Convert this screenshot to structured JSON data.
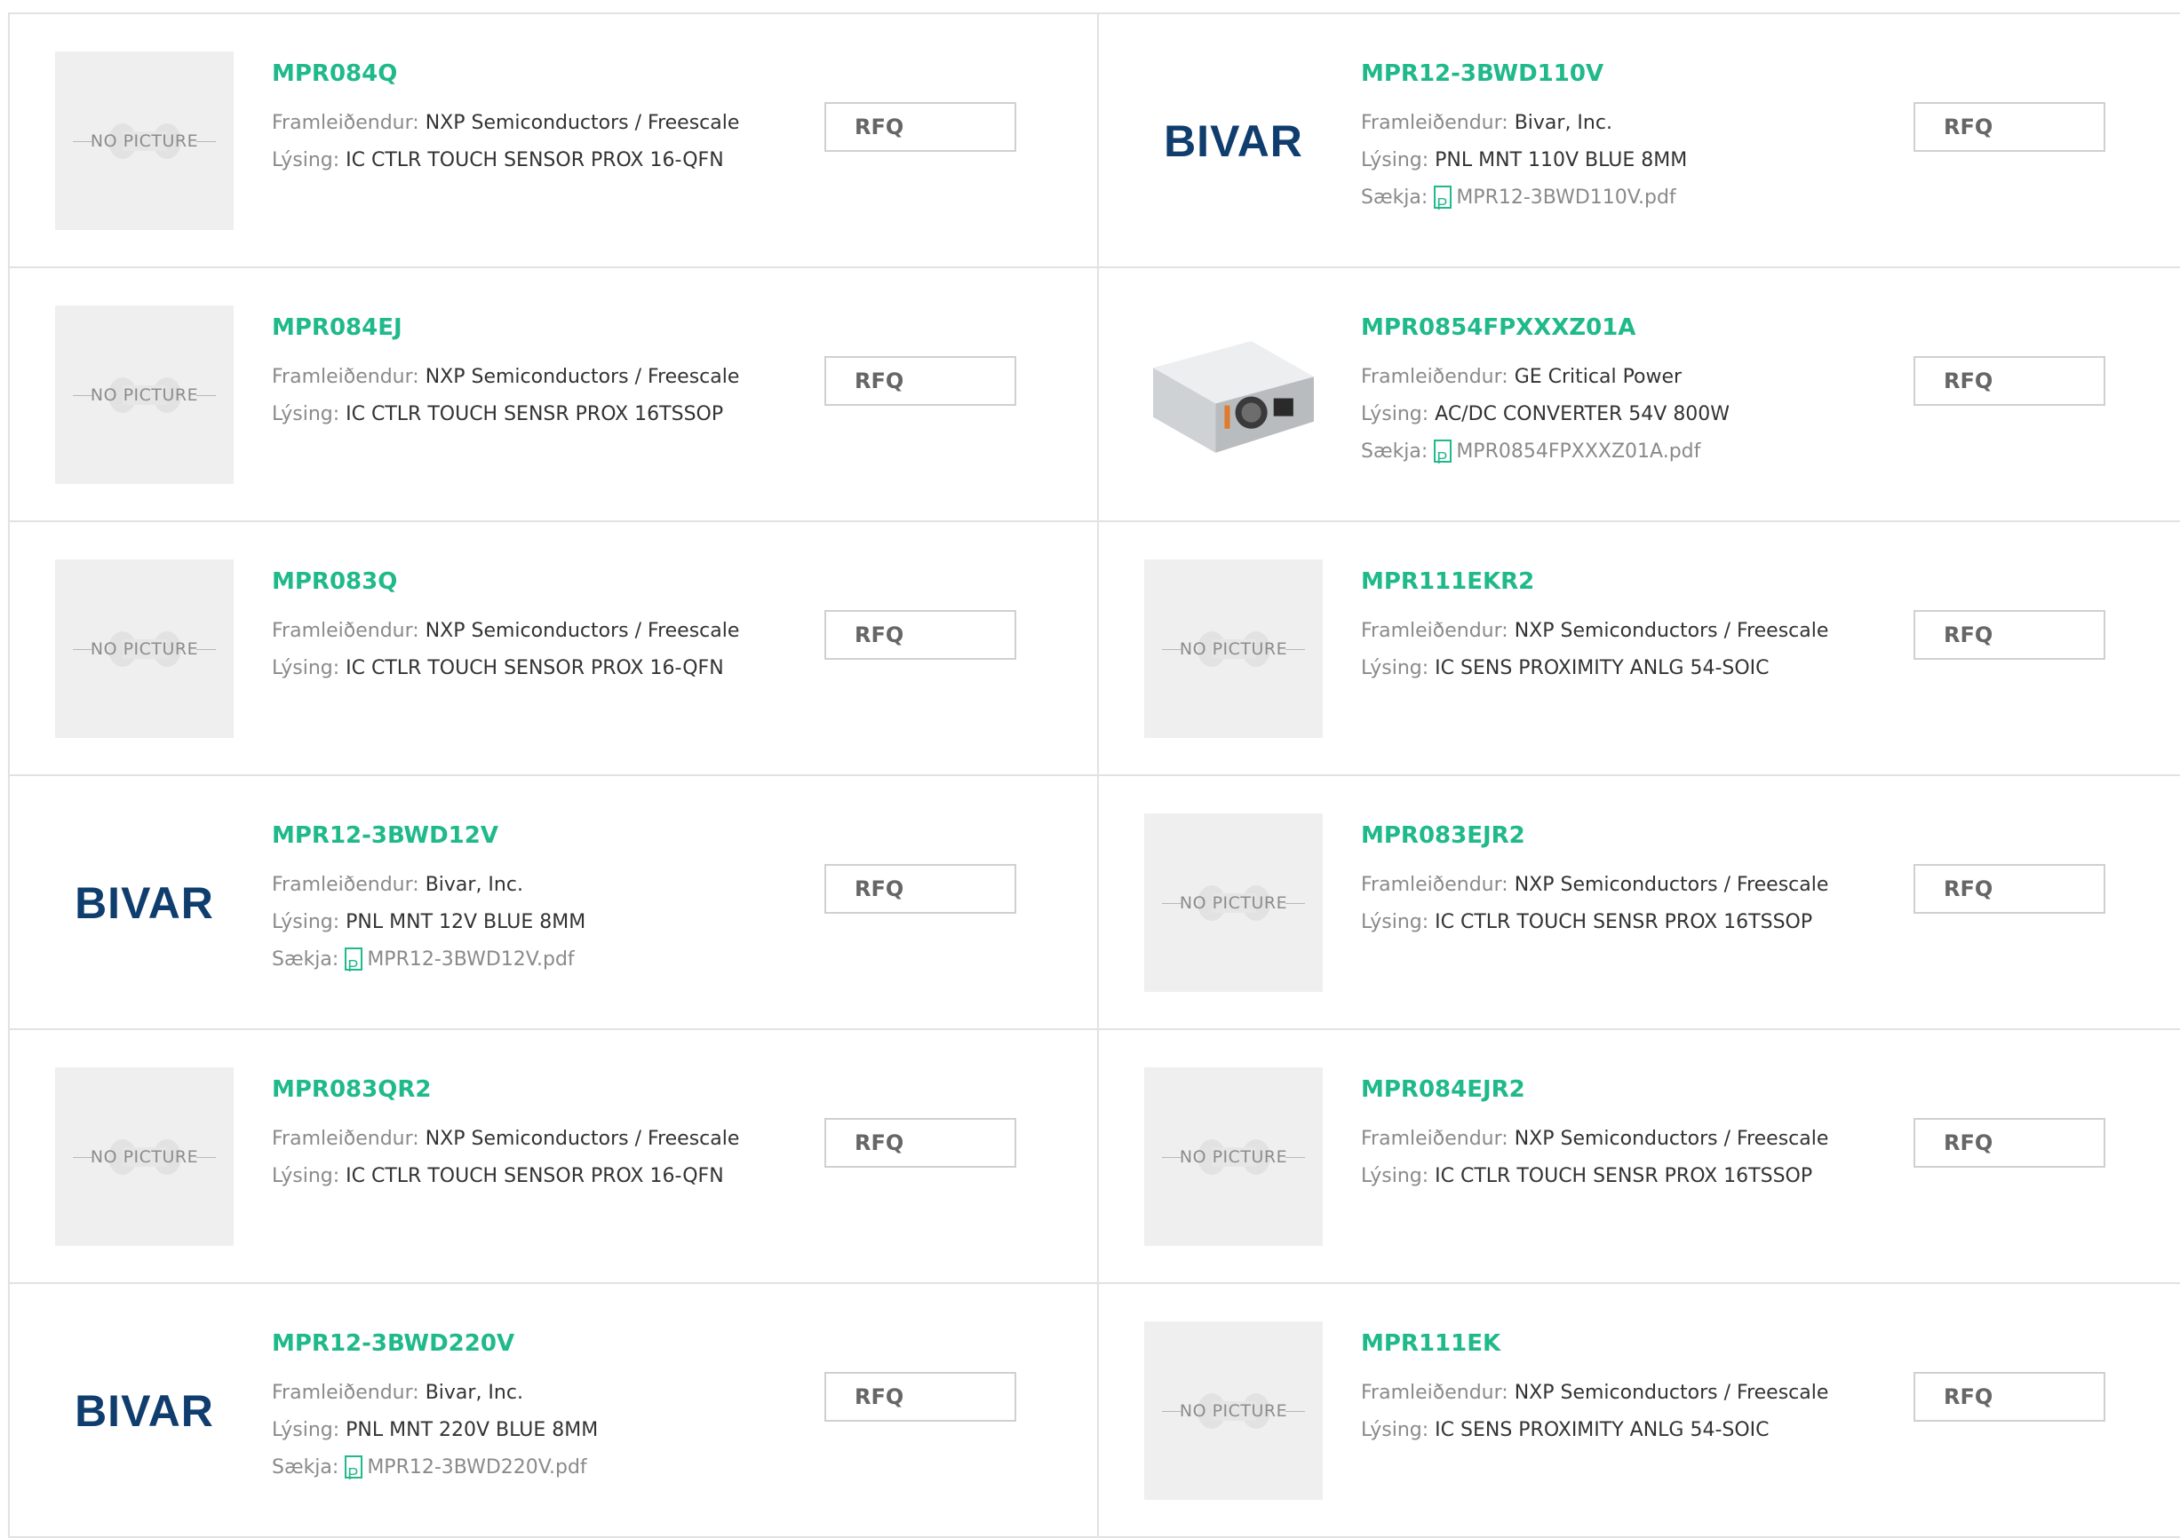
{
  "labels": {
    "manufacturer": "Framleiðendur:",
    "description": "Lýsing:",
    "download": "Sækja:",
    "rfq": "RFQ",
    "no_picture": "NO PICTURE"
  },
  "products": [
    {
      "pn": "MPR084Q",
      "mfr": "NXP Semiconductors / Freescale",
      "desc": "IC CTLR TOUCH SENSOR PROX 16-QFN",
      "pdf": "",
      "img": "no-picture"
    },
    {
      "pn": "MPR12-3BWD110V",
      "mfr": "Bivar, Inc.",
      "desc": "PNL MNT 110V BLUE 8MM",
      "pdf": "MPR12-3BWD110V.pdf",
      "img": "bivar-logo"
    },
    {
      "pn": "MPR084EJ",
      "mfr": "NXP Semiconductors / Freescale",
      "desc": "IC CTLR TOUCH SENSR PROX 16TSSOP",
      "pdf": "",
      "img": "no-picture"
    },
    {
      "pn": "MPR0854FPXXXZ01A",
      "mfr": "GE Critical Power",
      "desc": "AC/DC CONVERTER 54V 800W",
      "pdf": "MPR0854FPXXXZ01A.pdf",
      "img": "power-supply-photo"
    },
    {
      "pn": "MPR083Q",
      "mfr": "NXP Semiconductors / Freescale",
      "desc": "IC CTLR TOUCH SENSOR PROX 16-QFN",
      "pdf": "",
      "img": "no-picture"
    },
    {
      "pn": "MPR111EKR2",
      "mfr": "NXP Semiconductors / Freescale",
      "desc": "IC SENS PROXIMITY ANLG 54-SOIC",
      "pdf": "",
      "img": "no-picture"
    },
    {
      "pn": "MPR12-3BWD12V",
      "mfr": "Bivar, Inc.",
      "desc": "PNL MNT 12V BLUE 8MM",
      "pdf": "MPR12-3BWD12V.pdf",
      "img": "bivar-logo"
    },
    {
      "pn": "MPR083EJR2",
      "mfr": "NXP Semiconductors / Freescale",
      "desc": "IC CTLR TOUCH SENSR PROX 16TSSOP",
      "pdf": "",
      "img": "no-picture"
    },
    {
      "pn": "MPR083QR2",
      "mfr": "NXP Semiconductors / Freescale",
      "desc": "IC CTLR TOUCH SENSOR PROX 16-QFN",
      "pdf": "",
      "img": "no-picture"
    },
    {
      "pn": "MPR084EJR2",
      "mfr": "NXP Semiconductors / Freescale",
      "desc": "IC CTLR TOUCH SENSR PROX 16TSSOP",
      "pdf": "",
      "img": "no-picture"
    },
    {
      "pn": "MPR12-3BWD220V",
      "mfr": "Bivar, Inc.",
      "desc": "PNL MNT 220V BLUE 8MM",
      "pdf": "MPR12-3BWD220V.pdf",
      "img": "bivar-logo"
    },
    {
      "pn": "MPR111EK",
      "mfr": "NXP Semiconductors / Freescale",
      "desc": "IC SENS PROXIMITY ANLG 54-SOIC",
      "pdf": "",
      "img": "no-picture"
    }
  ],
  "brand": {
    "bivar_logo_text": "BIVAR"
  },
  "colors": {
    "accent": "#1fb98a",
    "logo": "#0f3d6e",
    "border": "#e2e2e2",
    "label": "#8a8a8a"
  }
}
